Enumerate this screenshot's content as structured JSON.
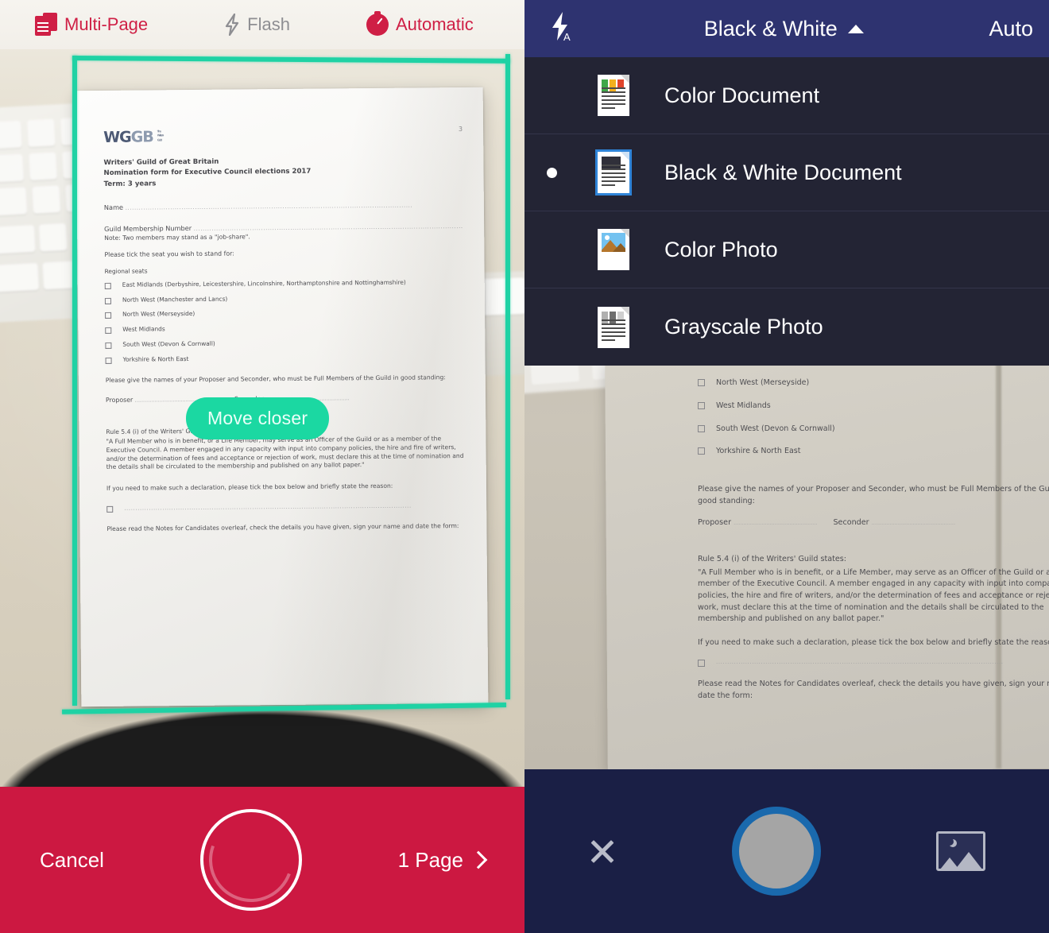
{
  "left": {
    "toolbar": {
      "multipage_label": "Multi-Page",
      "flash_label": "Flash",
      "automatic_label": "Automatic",
      "multipage_icon": "multi-page-document-icon",
      "flash_icon": "flash-bolt-icon",
      "automatic_icon": "stopwatch-icon"
    },
    "hint_pill": "Move closer",
    "bottom": {
      "cancel_label": "Cancel",
      "pages_label": "1 Page",
      "shutter_icon": "shutter-ring-icon",
      "chevron_icon": "chevron-right-icon"
    },
    "colors": {
      "accent_red": "#CC1841",
      "crop_teal": "#1FD2A4",
      "pill_teal": "#1BD8A2",
      "toolbar_bg": "#F4F1EC"
    }
  },
  "right": {
    "header": {
      "flash_icon": "flash-auto-icon",
      "mode_label": "Black & White",
      "caret_icon": "caret-up-icon",
      "auto_label": "Auto"
    },
    "dropdown": {
      "items": [
        {
          "label": "Color Document",
          "icon": "color-document-icon",
          "selected": false
        },
        {
          "label": "Black & White Document",
          "icon": "black-white-document-icon",
          "selected": true
        },
        {
          "label": "Color Photo",
          "icon": "color-photo-icon",
          "selected": false
        },
        {
          "label": "Grayscale Photo",
          "icon": "grayscale-photo-icon",
          "selected": false
        }
      ]
    },
    "bottom": {
      "close_icon": "close-x-icon",
      "shutter_icon": "shutter-circle-icon",
      "gallery_icon": "gallery-image-icon"
    },
    "colors": {
      "header_navy": "#2E3370",
      "dropdown_bg": "#232434",
      "bottom_navy": "#1A1F45",
      "shutter_ring_blue": "#1A69AD"
    }
  },
  "document": {
    "logo_main": "WG",
    "logo_accent": "GB",
    "logo_tagline": "The\nWriters\nGuild",
    "page_number": "3",
    "heading_1": "Writers' Guild of Great Britain",
    "heading_2": "Nomination form for Executive Council elections 2017",
    "heading_3": "Term: 3 years",
    "name_label": "Name",
    "membership_label": "Guild Membership Number",
    "membership_note": "Note: Two members may stand as a \"job-share\".",
    "tick_instruction": "Please tick the seat you wish to stand for:",
    "regional_heading": "Regional seats",
    "regional_seats": [
      "East Midlands (Derbyshire, Leicestershire, Lincolnshire, Northamptonshire and Nottinghamshire)",
      "North West (Manchester and Lancs)",
      "North West (Merseyside)",
      "West Midlands",
      "South West (Devon & Cornwall)",
      "Yorkshire & North East"
    ],
    "proposer_para": "Please give the names of your Proposer and Seconder, who must be Full Members of the Guild in good standing:",
    "proposer_label": "Proposer",
    "seconder_label": "Seconder",
    "rule_heading": "Rule 5.4 (i) of the Writers' Guild states:",
    "rule_body": "\"A Full Member who is in benefit, or a Life Member, may serve as an Officer of the Guild or as a member of the Executive Council. A member engaged in any capacity with input into company policies, the hire and fire of writers, and/or the determination of fees and acceptance or rejection of work, must declare this at the time of nomination and the details shall be circulated to the membership and published on any ballot paper.\"",
    "declaration_para": "If you need to make such a declaration, please tick the box below and briefly state the reason:",
    "notes_para": "Please read the Notes for Candidates overleaf, check the details you have given, sign your name and date the form:",
    "dots_line": "................................................................................................................................",
    "dots_short": "..................................................."
  }
}
